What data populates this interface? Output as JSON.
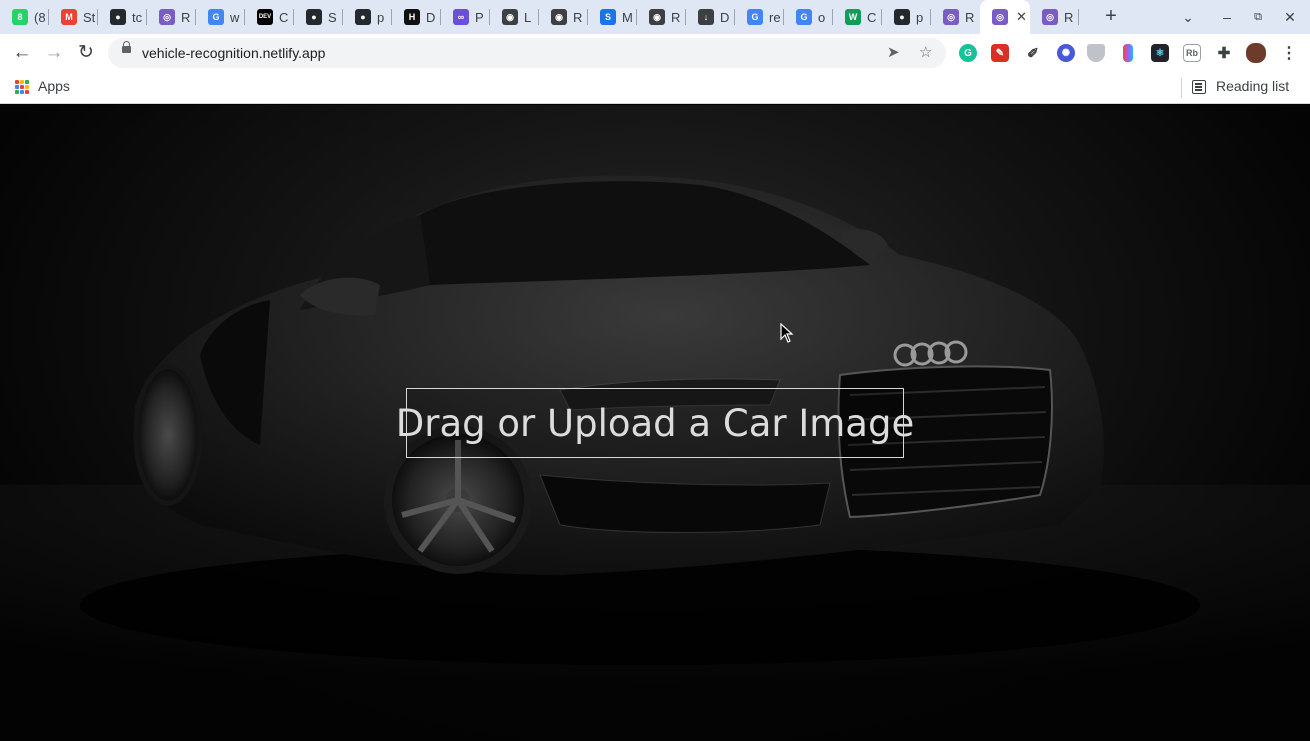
{
  "browser": {
    "tabs": [
      {
        "title": "(8",
        "icon": "whatsapp-icon",
        "color": "#25d366",
        "glyph": "8"
      },
      {
        "title": "St",
        "icon": "gmail-icon",
        "color": "#ea4335",
        "glyph": "M"
      },
      {
        "title": "tc",
        "icon": "github-icon",
        "color": "#24292e",
        "glyph": "●"
      },
      {
        "title": "R",
        "icon": "react-app-icon",
        "color": "#7a5cc7",
        "glyph": "◎"
      },
      {
        "title": "w",
        "icon": "google-icon",
        "color": "#4285f4",
        "glyph": "G"
      },
      {
        "title": "C",
        "icon": "dev-icon",
        "color": "#000000",
        "glyph": "DEV"
      },
      {
        "title": "S",
        "icon": "github-icon",
        "color": "#24292e",
        "glyph": "●"
      },
      {
        "title": "p",
        "icon": "github-icon",
        "color": "#24292e",
        "glyph": "●"
      },
      {
        "title": "D",
        "icon": "hashnode-icon",
        "color": "#111111",
        "glyph": "H"
      },
      {
        "title": "P",
        "icon": "patreon-icon",
        "color": "#6b4fd8",
        "glyph": "∞"
      },
      {
        "title": "L",
        "icon": "globe-icon",
        "color": "#3c4043",
        "glyph": "◉"
      },
      {
        "title": "R",
        "icon": "globe-icon",
        "color": "#3c4043",
        "glyph": "◉"
      },
      {
        "title": "M",
        "icon": "stripe-icon",
        "color": "#1a73e8",
        "glyph": "S"
      },
      {
        "title": "R",
        "icon": "globe-icon",
        "color": "#3c4043",
        "glyph": "◉"
      },
      {
        "title": "D",
        "icon": "download-icon",
        "color": "#3c4043",
        "glyph": "↓"
      },
      {
        "title": "re",
        "icon": "google-icon",
        "color": "#4285f4",
        "glyph": "G"
      },
      {
        "title": "o",
        "icon": "google-icon",
        "color": "#4285f4",
        "glyph": "G"
      },
      {
        "title": "C",
        "icon": "webflow-icon",
        "color": "#0f9d58",
        "glyph": "W"
      },
      {
        "title": "p",
        "icon": "github-icon",
        "color": "#24292e",
        "glyph": "●"
      },
      {
        "title": "R",
        "icon": "react-app-icon",
        "color": "#7a5cc7",
        "glyph": "◎"
      },
      {
        "title": "",
        "icon": "react-app-icon",
        "color": "#7a5cc7",
        "glyph": "◎",
        "active": true
      },
      {
        "title": "R",
        "icon": "react-app-icon",
        "color": "#7a5cc7",
        "glyph": "◎"
      }
    ],
    "new_tab": "+",
    "tab_close": "✕",
    "url": "vehicle-recognition.netlify.app",
    "bookmarks": {
      "apps_label": "Apps",
      "reading_list_label": "Reading list"
    }
  },
  "page": {
    "upload_label": "Drag or Upload a Car Image",
    "background": "dark sports car photo"
  }
}
